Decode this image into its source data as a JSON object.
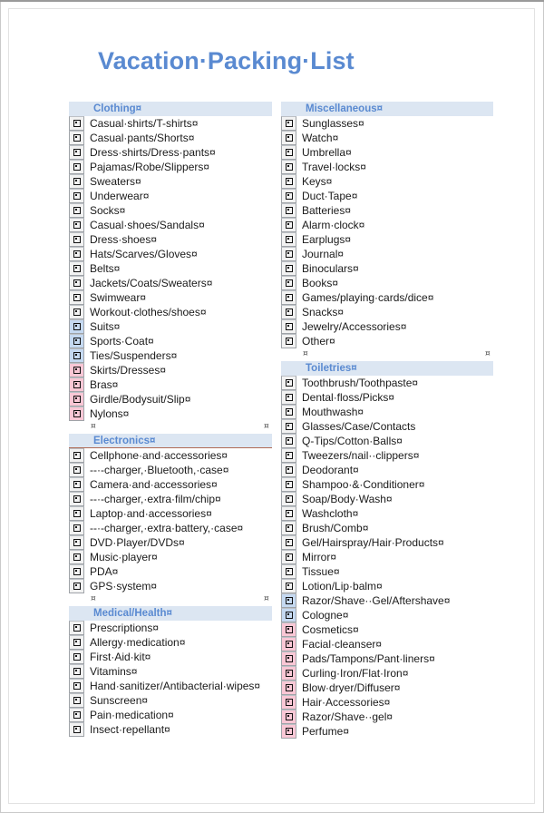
{
  "document": {
    "title": "Vacation·Packing·List",
    "title_plain": "Vacation Packing List",
    "cell_mark": "¤",
    "handle_mark": "⌗",
    "colors": {
      "title": "#5a8ad1",
      "section_header_bg": "#dce6f2",
      "section_header_text": "#5a8ad1",
      "checkbox_default_bg": "#f2f2f2",
      "checkbox_men_bg": "#c5d9f1",
      "checkbox_women_bg": "#f9c7d5",
      "page_border": "#c9c9c9"
    }
  },
  "columns": {
    "left": [
      {
        "header": "Clothing¤",
        "header_marked": false,
        "items": [
          {
            "text": "Casual·shirts/T-shirts¤",
            "gender": "none"
          },
          {
            "text": "Casual·pants/Shorts¤",
            "gender": "none"
          },
          {
            "text": "Dress·shirts/Dress·pants¤",
            "gender": "none"
          },
          {
            "text": "Pajamas/Robe/Slippers¤",
            "gender": "none"
          },
          {
            "text": "Sweaters¤",
            "gender": "none"
          },
          {
            "text": "Underwear¤",
            "gender": "none"
          },
          {
            "text": "Socks¤",
            "gender": "none"
          },
          {
            "text": "Casual·shoes/Sandals¤",
            "gender": "none"
          },
          {
            "text": "Dress·shoes¤",
            "gender": "none"
          },
          {
            "text": "Hats/Scarves/Gloves¤",
            "gender": "none"
          },
          {
            "text": "Belts¤",
            "gender": "none"
          },
          {
            "text": "Jackets/Coats/Sweaters¤",
            "gender": "none"
          },
          {
            "text": "Swimwear¤",
            "gender": "none"
          },
          {
            "text": "Workout·clothes/shoes¤",
            "gender": "none"
          },
          {
            "text": "Suits¤",
            "gender": "men"
          },
          {
            "text": "Sports·Coat¤",
            "gender": "men"
          },
          {
            "text": "Ties/Suspenders¤",
            "gender": "men"
          },
          {
            "text": "Skirts/Dresses¤",
            "gender": "women"
          },
          {
            "text": "Bras¤",
            "gender": "women"
          },
          {
            "text": "Girdle/Bodysuit/Slip¤",
            "gender": "women"
          },
          {
            "text": "Nylons¤",
            "gender": "women"
          }
        ]
      },
      {
        "header": "Electronics¤",
        "header_marked": true,
        "items": [
          {
            "text": "Cellphone·and·accessories¤",
            "gender": "none"
          },
          {
            "text": "--·-charger,·Bluetooth,·case¤",
            "gender": "none"
          },
          {
            "text": "Camera·and·accessories¤",
            "gender": "none"
          },
          {
            "text": "--·-charger,·extra·film/chip¤",
            "gender": "none"
          },
          {
            "text": "Laptop·and·accessories¤",
            "gender": "none"
          },
          {
            "text": "--·-charger,·extra·battery,·case¤",
            "gender": "none"
          },
          {
            "text": "DVD·Player/DVDs¤",
            "gender": "none"
          },
          {
            "text": "Music·player¤",
            "gender": "none"
          },
          {
            "text": "PDA¤",
            "gender": "none"
          },
          {
            "text": "GPS·system¤",
            "gender": "none"
          }
        ]
      },
      {
        "header": "Medical/Health¤",
        "header_marked": false,
        "items": [
          {
            "text": "Prescriptions¤",
            "gender": "none"
          },
          {
            "text": "Allergy·medication¤",
            "gender": "none"
          },
          {
            "text": "First·Aid·kit¤",
            "gender": "none"
          },
          {
            "text": "Vitamins¤",
            "gender": "none"
          },
          {
            "text": "Hand·sanitizer/Antibacterial·wipes¤",
            "gender": "none"
          },
          {
            "text": "Sunscreen¤",
            "gender": "none"
          },
          {
            "text": "Pain·medication¤",
            "gender": "none"
          },
          {
            "text": "Insect·repellant¤",
            "gender": "none"
          }
        ]
      }
    ],
    "right": [
      {
        "header": "Miscellaneous¤",
        "header_marked": false,
        "items": [
          {
            "text": "Sunglasses¤",
            "gender": "none"
          },
          {
            "text": "Watch¤",
            "gender": "none"
          },
          {
            "text": "Umbrella¤",
            "gender": "none"
          },
          {
            "text": "Travel·locks¤",
            "gender": "none"
          },
          {
            "text": "Keys¤",
            "gender": "none"
          },
          {
            "text": "Duct·Tape¤",
            "gender": "none"
          },
          {
            "text": "Batteries¤",
            "gender": "none"
          },
          {
            "text": "Alarm·clock¤",
            "gender": "none"
          },
          {
            "text": "Earplugs¤",
            "gender": "none"
          },
          {
            "text": "Journal¤",
            "gender": "none"
          },
          {
            "text": "Binoculars¤",
            "gender": "none"
          },
          {
            "text": "Books¤",
            "gender": "none"
          },
          {
            "text": "Games/playing·cards/dice¤",
            "gender": "none"
          },
          {
            "text": "Snacks¤",
            "gender": "none"
          },
          {
            "text": "Jewelry/Accessories¤",
            "gender": "none"
          },
          {
            "text": "Other¤",
            "gender": "none"
          }
        ]
      },
      {
        "header": "Toiletries¤",
        "header_marked": false,
        "items": [
          {
            "text": "Toothbrush/Toothpaste¤",
            "gender": "none"
          },
          {
            "text": "Dental·floss/Picks¤",
            "gender": "none"
          },
          {
            "text": "Mouthwash¤",
            "gender": "none"
          },
          {
            "text": "Glasses/Case/Contacts",
            "gender": "none"
          },
          {
            "text": "Q-Tips/Cotton·Balls¤",
            "gender": "none"
          },
          {
            "text": "Tweezers/nail··clippers¤",
            "gender": "none"
          },
          {
            "text": "Deodorant¤",
            "gender": "none"
          },
          {
            "text": "Shampoo·&·Conditioner¤",
            "gender": "none"
          },
          {
            "text": "Soap/Body·Wash¤",
            "gender": "none"
          },
          {
            "text": "Washcloth¤",
            "gender": "none"
          },
          {
            "text": "Brush/Comb¤",
            "gender": "none"
          },
          {
            "text": "Gel/Hairspray/Hair·Products¤",
            "gender": "none"
          },
          {
            "text": "Mirror¤",
            "gender": "none"
          },
          {
            "text": "Tissue¤",
            "gender": "none"
          },
          {
            "text": "Lotion/Lip·balm¤",
            "gender": "none"
          },
          {
            "text": "Razor/Shave··Gel/Aftershave¤",
            "gender": "men"
          },
          {
            "text": "Cologne¤",
            "gender": "men"
          },
          {
            "text": "Cosmetics¤",
            "gender": "women"
          },
          {
            "text": "Facial·cleanser¤",
            "gender": "women"
          },
          {
            "text": "Pads/Tampons/Pant·liners¤",
            "gender": "women"
          },
          {
            "text": "Curling·Iron/Flat·Iron¤",
            "gender": "women"
          },
          {
            "text": "Blow·dryer/Diffuser¤",
            "gender": "women"
          },
          {
            "text": "Hair·Accessories¤",
            "gender": "women"
          },
          {
            "text": "Razor/Shave··gel¤",
            "gender": "women"
          },
          {
            "text": "Perfume¤",
            "gender": "women"
          }
        ]
      }
    ]
  }
}
